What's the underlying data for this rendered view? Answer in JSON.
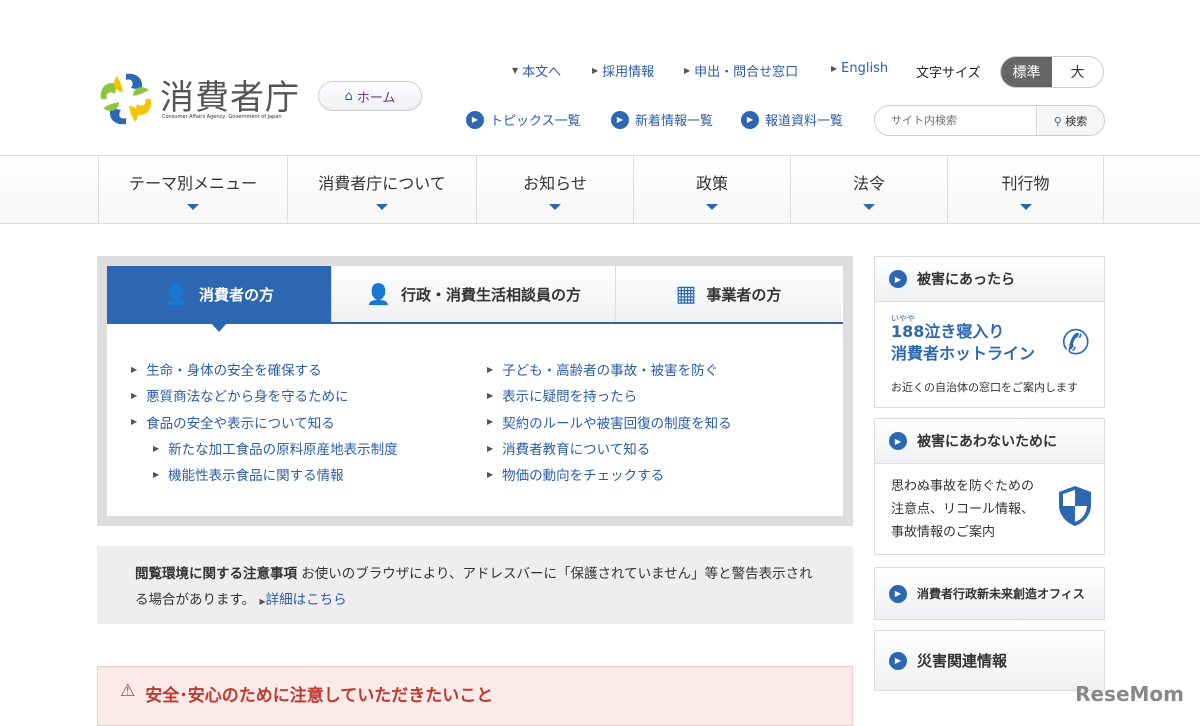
{
  "header": {
    "logo_text": "消費者庁",
    "logo_sub": "Consumer Affairs Agency, Government of Japan",
    "home": "ホーム",
    "util_links": [
      "本文へ",
      "採用情報",
      "申出・問合せ窓口",
      "English"
    ],
    "font_size_label": "文字サイズ",
    "font_standard": "標準",
    "font_large": "大",
    "sub_links": [
      "トピックス一覧",
      "新着情報一覧",
      "報道資料一覧"
    ],
    "search_placeholder": "サイト内検索",
    "search_button": "検索"
  },
  "nav": [
    "テーマ別メニュー",
    "消費者庁について",
    "お知らせ",
    "政策",
    "法令",
    "刊行物"
  ],
  "tabs": [
    "消費者の方",
    "行政・消費生活相談員の方",
    "事業者の方"
  ],
  "left_list": [
    "生命・身体の安全を確保する",
    "悪質商法などから身を守るために",
    "食品の安全や表示について知る",
    "新たな加工食品の原料原産地表示制度",
    "機能性表示食品に関する情報"
  ],
  "right_list": [
    "子ども・高齢者の事故・被害を防ぐ",
    "表示に疑問を持ったら",
    "契約のルールや被害回復の制度を知る",
    "消費者教育について知る",
    "物価の動向をチェックする"
  ],
  "notice": {
    "title": "閲覧環境に関する注意事項",
    "body": "お使いのブラウザにより、アドレスバーに「保護されていません」等と警告表示される場合があります。",
    "link": "詳細はこちら"
  },
  "warning": "安全･安心のために注意していただきたいこと",
  "side": {
    "box1": {
      "title": "被害にあったら",
      "ruby": "いやや",
      "line1": "188泣き寝入り",
      "line2": "消費者ホットライン",
      "desc": "お近くの自治体の窓口をご案内します"
    },
    "box2": {
      "title": "被害にあわないために",
      "desc": "思わぬ事故を防ぐための注意点、リコール情報、事故情報のご案内"
    },
    "box3": {
      "title": "消費者行政新未来創造オフィス"
    },
    "box4": {
      "title": "災害関連情報"
    }
  },
  "watermark": "ReseMom"
}
